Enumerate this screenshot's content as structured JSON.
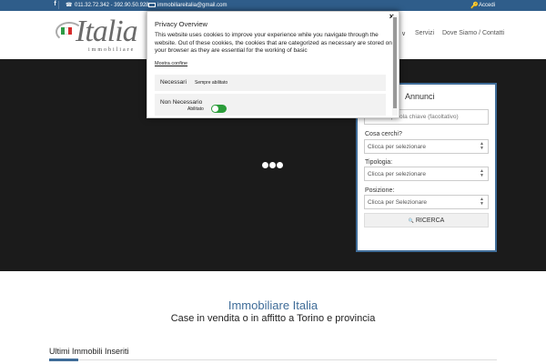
{
  "topbar": {
    "facebook_icon": "f",
    "phone_icon": "☎",
    "phone": "011.32.72.342 - 392.90.50.928",
    "email": "immobiliareitalia@gmail.com",
    "login_icon": "🔑",
    "login": "Accedi"
  },
  "header": {
    "logo": {
      "word": "Italia",
      "sub": "immobiliare"
    },
    "nav": {
      "chevron": "∨",
      "servizi": "Servizi",
      "dove": "Dove Siamo / Contatti"
    }
  },
  "search": {
    "title": "Annunci",
    "keyword_placeholder": "Inserisci parola chiave (facoltativo)",
    "cosa_label": "Cosa cerchi?",
    "cosa_value": "Clicca per selezionare",
    "tipologia_label": "Tipologia:",
    "tipologia_value": "Clicca per selezionare",
    "posizione_label": "Posizione:",
    "posizione_value": "Clicca per Selezionare",
    "search_button": "RICERCA",
    "search_icon": "🔍"
  },
  "content": {
    "title": "Immobiliare Italia",
    "subtitle": "Case in vendita o in affitto a Torino e provincia",
    "section": "Ultimi Immobili Inseriti"
  },
  "modal": {
    "title": "Privacy Overview",
    "close": "×",
    "body": "This website uses cookies to improve your experience while you navigate through the website. Out of these cookies, the cookies that are categorized as necessary are stored on your browser as they are essential for the working of basic",
    "link": "Mostra confine",
    "necessari_label": "Necessari",
    "necessari_state": "Sempre abilitato",
    "non_label": "Non Necessario",
    "non_state": "Abilitato"
  },
  "colors": {
    "topbar": "#2f5d8a",
    "accent": "#3f6c98",
    "toggle_on": "#2b9d3a"
  }
}
